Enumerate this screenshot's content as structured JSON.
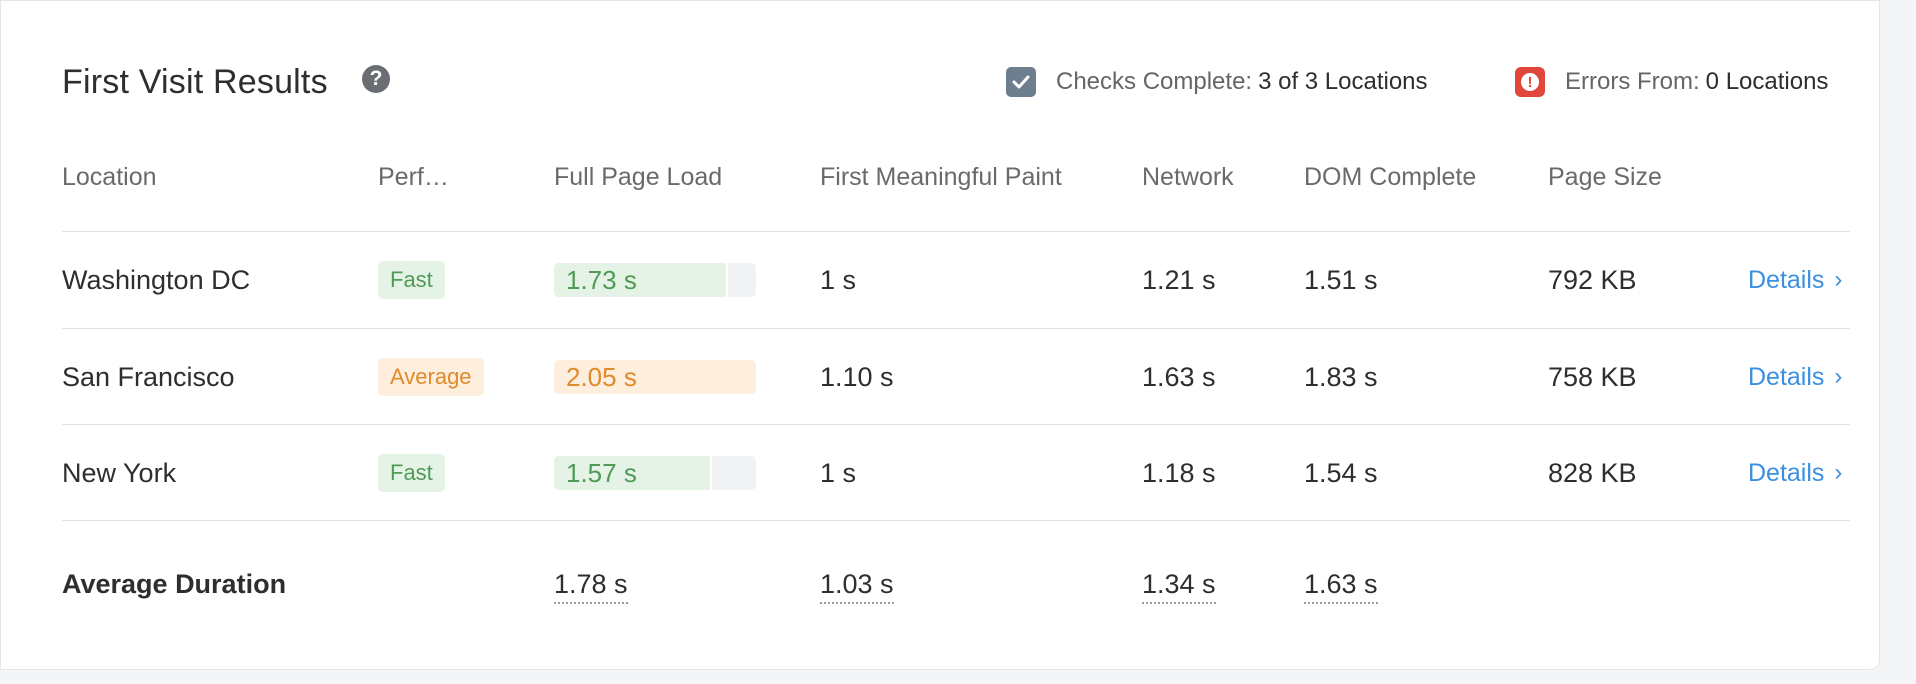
{
  "header": {
    "title": "First Visit Results",
    "help_icon": "question-circle-icon",
    "checks_label": "Checks Complete:",
    "checks_value": "3 of 3 Locations",
    "errors_label": "Errors From:",
    "errors_value": "0 Locations"
  },
  "columns": [
    "Location",
    "Perf…",
    "Full Page Load",
    "First Meaningful Paint",
    "Network",
    "DOM Complete",
    "Page Size"
  ],
  "rows": [
    {
      "location": "Washington DC",
      "perf": "Fast",
      "load": "1.73 s",
      "load_fraction": 0.85,
      "fmp": "1 s",
      "network": "1.21 s",
      "dom": "1.51 s",
      "size": "792 KB",
      "details": "Details"
    },
    {
      "location": "San Francisco",
      "perf": "Average",
      "load": "2.05 s",
      "load_fraction": 1.0,
      "fmp": "1.10 s",
      "network": "1.63 s",
      "dom": "1.83 s",
      "size": "758 KB",
      "details": "Details"
    },
    {
      "location": "New York",
      "perf": "Fast",
      "load": "1.57 s",
      "load_fraction": 0.77,
      "fmp": "1 s",
      "network": "1.18 s",
      "dom": "1.54 s",
      "size": "828 KB",
      "details": "Details"
    }
  ],
  "averages": {
    "label": "Average Duration",
    "load": "1.78 s",
    "fmp": "1.03 s",
    "network": "1.34 s",
    "dom": "1.63 s"
  },
  "colors": {
    "fast": "#4f9a55",
    "average": "#e08a2c",
    "link": "#3b8fe0",
    "error": "#e0463c"
  }
}
